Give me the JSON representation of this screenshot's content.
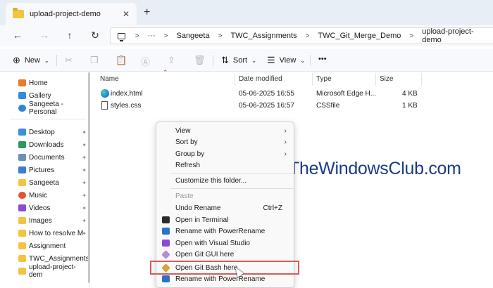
{
  "window": {
    "tab_title": "upload-project-demo",
    "close_glyph": "✕",
    "new_tab_glyph": "+"
  },
  "nav": {
    "back_glyph": "←",
    "forward_glyph": "→",
    "up_glyph": "↑",
    "refresh_glyph": "↻",
    "more_glyph": "···",
    "breadcrumbs": [
      "Sangeeta",
      "TWC_Assignments",
      "TWC_Git_Merge_Demo",
      "upload-project-demo"
    ],
    "separator": ">"
  },
  "toolbar": {
    "new_label": "New",
    "sort_label": "Sort",
    "view_label": "View",
    "more_glyph": "•••"
  },
  "sidebar": {
    "top_items": [
      {
        "label": "Home",
        "color": "#e8792d"
      },
      {
        "label": "Gallery",
        "color": "#2e8de0"
      },
      {
        "label": "Sangeeta - Personal",
        "color": "#2b87d6"
      }
    ],
    "pinned_items": [
      {
        "label": "Desktop",
        "color": "#3a8ee6"
      },
      {
        "label": "Downloads",
        "color": "#2a9a5a"
      },
      {
        "label": "Documents",
        "color": "#6c8fb5"
      },
      {
        "label": "Pictures",
        "color": "#3c7dd1"
      },
      {
        "label": "Sangeeta",
        "color": "#f5c342"
      },
      {
        "label": "Music",
        "color": "#e0562b"
      },
      {
        "label": "Videos",
        "color": "#8a4bd6"
      },
      {
        "label": "Images",
        "color": "#f5c342"
      },
      {
        "label": "How to resolve M",
        "color": "#f5c342"
      },
      {
        "label": "Assignment",
        "color": "#f5c342"
      },
      {
        "label": "TWC_Assignments",
        "color": "#f5c342"
      },
      {
        "label": "upload-project-dem",
        "color": "#f5c342"
      }
    ],
    "pin_glyph": "📌"
  },
  "file_list": {
    "columns": [
      "Name",
      "Date modified",
      "Type",
      "Size"
    ],
    "rows": [
      {
        "name": "index.html",
        "date": "05-06-2025 16:55",
        "type": "Microsoft Edge H...",
        "size": "4 KB",
        "icon": "edge-icon"
      },
      {
        "name": "styles.css",
        "date": "05-06-2025 16:57",
        "type": "CSSfile",
        "size": "1 KB",
        "icon": "document-icon"
      }
    ]
  },
  "context_menu": {
    "view": "View",
    "sort_by": "Sort by",
    "group_by": "Group by",
    "refresh": "Refresh",
    "customize": "Customize this folder...",
    "paste": "Paste",
    "undo_rename": "Undo Rename",
    "undo_shortcut": "Ctrl+Z",
    "open_terminal": "Open in Terminal",
    "rename_powerrename": "Rename with PowerRename",
    "open_vs": "Open with Visual Studio",
    "git_gui": "Open Git GUI here",
    "git_bash": "Open Git Bash here",
    "rename_powerrename_2": "Rename with PowerRename",
    "arrow_glyph": "›"
  },
  "watermark": {
    "text": "TheWindowsClub.com"
  }
}
